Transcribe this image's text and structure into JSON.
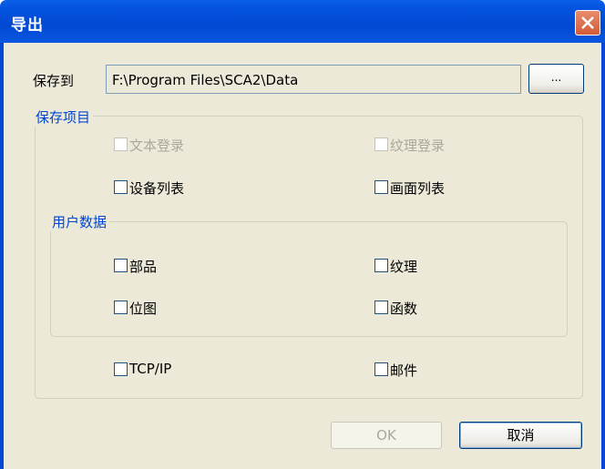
{
  "window": {
    "title": "导出"
  },
  "save_to": {
    "label": "保存到",
    "path": "F:\\Program Files\\SCA2\\Data",
    "browse_label": "..."
  },
  "save_items": {
    "title": "保存项目",
    "text_login": {
      "label": "文本登录",
      "checked": false,
      "enabled": false
    },
    "texture_login": {
      "label": "纹理登录",
      "checked": false,
      "enabled": false
    },
    "device_list": {
      "label": "设备列表",
      "checked": false,
      "enabled": true
    },
    "screen_list": {
      "label": "画面列表",
      "checked": false,
      "enabled": true
    },
    "user_data": {
      "title": "用户数据",
      "parts": {
        "label": "部品",
        "checked": false
      },
      "texture": {
        "label": "纹理",
        "checked": false
      },
      "bitmap": {
        "label": "位图",
        "checked": false
      },
      "function": {
        "label": "函数",
        "checked": false
      }
    },
    "tcpip": {
      "label": "TCP/IP",
      "checked": false
    },
    "mail": {
      "label": "邮件",
      "checked": false
    }
  },
  "buttons": {
    "ok": "OK",
    "cancel": "取消"
  }
}
